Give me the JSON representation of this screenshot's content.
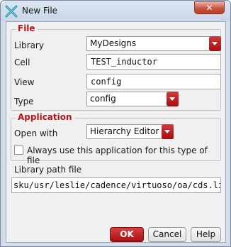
{
  "window": {
    "title": "New File",
    "close_glyph": "✕"
  },
  "file_group": {
    "title": "File",
    "library": {
      "label": "Library",
      "value": "MyDesigns"
    },
    "cell": {
      "label": "Cell",
      "value": "TEST_inductor"
    },
    "view": {
      "label": "View",
      "value": "config"
    },
    "type": {
      "label": "Type",
      "value": "config"
    }
  },
  "application_group": {
    "title": "Application",
    "open_with": {
      "label": "Open with",
      "value": "Hierarchy Editor"
    },
    "always_use": {
      "label": "Always use this application for this type of file",
      "checked": false
    }
  },
  "library_path": {
    "label": "Library path file",
    "value": "sku/usr/leslie/cadence/virtuoso/oa/cds.lib"
  },
  "buttons": {
    "ok": "OK",
    "cancel": "Cancel",
    "help": "Help"
  },
  "colors": {
    "accent": "#b01818",
    "dropdown": "#c02020"
  }
}
